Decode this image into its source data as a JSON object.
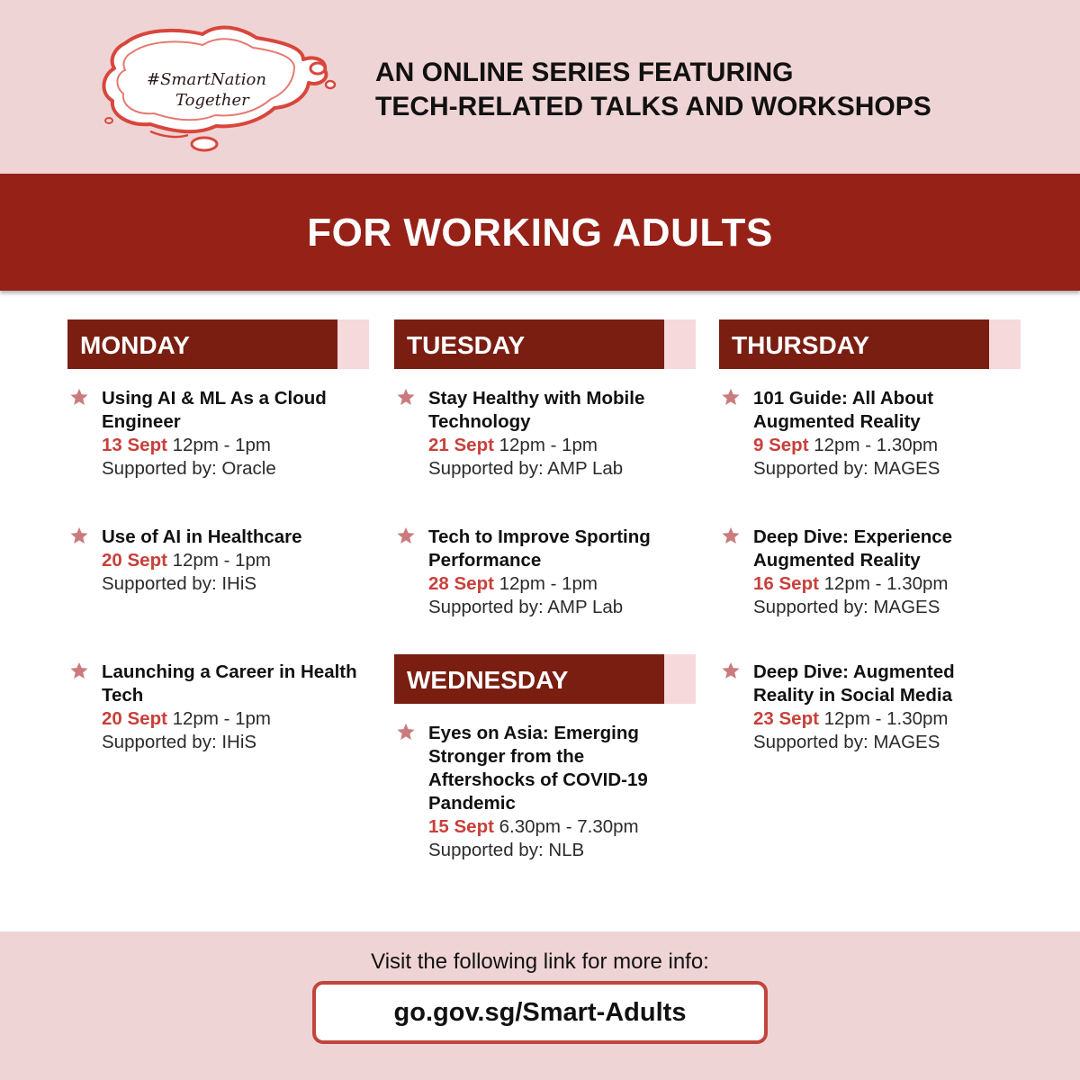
{
  "logo": {
    "line1": "#SmartNation",
    "line2": "Together"
  },
  "intro": {
    "line1": "AN ONLINE SERIES FEATURING",
    "line2": "TECH-RELATED TALKS AND WORKSHOPS"
  },
  "banner": {
    "title": "FOR WORKING ADULTS"
  },
  "days": {
    "monday": "MONDAY",
    "tuesday": "TUESDAY",
    "wednesday": "WEDNESDAY",
    "thursday": "THURSDAY"
  },
  "events": {
    "mon1": {
      "title": "Using AI & ML As a Cloud Engineer",
      "date": "13 Sept",
      "time": "12pm - 1pm",
      "support": "Supported by: Oracle"
    },
    "mon2": {
      "title": "Use of AI in Healthcare",
      "date": "20 Sept",
      "time": "12pm - 1pm",
      "support": "Supported by: IHiS"
    },
    "mon3": {
      "title": "Launching a Career in Health Tech",
      "date": "20 Sept",
      "time": "12pm - 1pm",
      "support": "Supported by: IHiS"
    },
    "tue1": {
      "title": "Stay Healthy with Mobile Technology",
      "date": "21 Sept",
      "time": "12pm - 1pm",
      "support": "Supported by: AMP Lab"
    },
    "tue2": {
      "title": "Tech to Improve Sporting Performance",
      "date": "28 Sept",
      "time": "12pm - 1pm",
      "support": "Supported by: AMP Lab"
    },
    "wed1": {
      "title": "Eyes on Asia: Emerging Stronger from the Aftershocks of COVID-19 Pandemic",
      "date": "15 Sept",
      "time": "6.30pm - 7.30pm",
      "support": "Supported by: NLB"
    },
    "thu1": {
      "title": "101 Guide: All About Augmented Reality",
      "date": "9 Sept",
      "time": "12pm - 1.30pm",
      "support": "Supported by: MAGES"
    },
    "thu2": {
      "title": "Deep Dive: Experience Augmented Reality",
      "date": "16 Sept",
      "time": "12pm - 1.30pm",
      "support": "Supported by: MAGES"
    },
    "thu3": {
      "title": "Deep Dive: Augmented Reality in Social Media",
      "date": "23 Sept",
      "time": "12pm - 1.30pm",
      "support": "Supported by: MAGES"
    }
  },
  "footer": {
    "text": "Visit the following link for more info:",
    "link": "go.gov.sg/Smart-Adults"
  },
  "colors": {
    "header_bg": "#efd4d5",
    "banner_bg": "#962117",
    "day_bar": "#7a1e12",
    "date_accent": "#c8403a",
    "star": "#c97b7e"
  }
}
